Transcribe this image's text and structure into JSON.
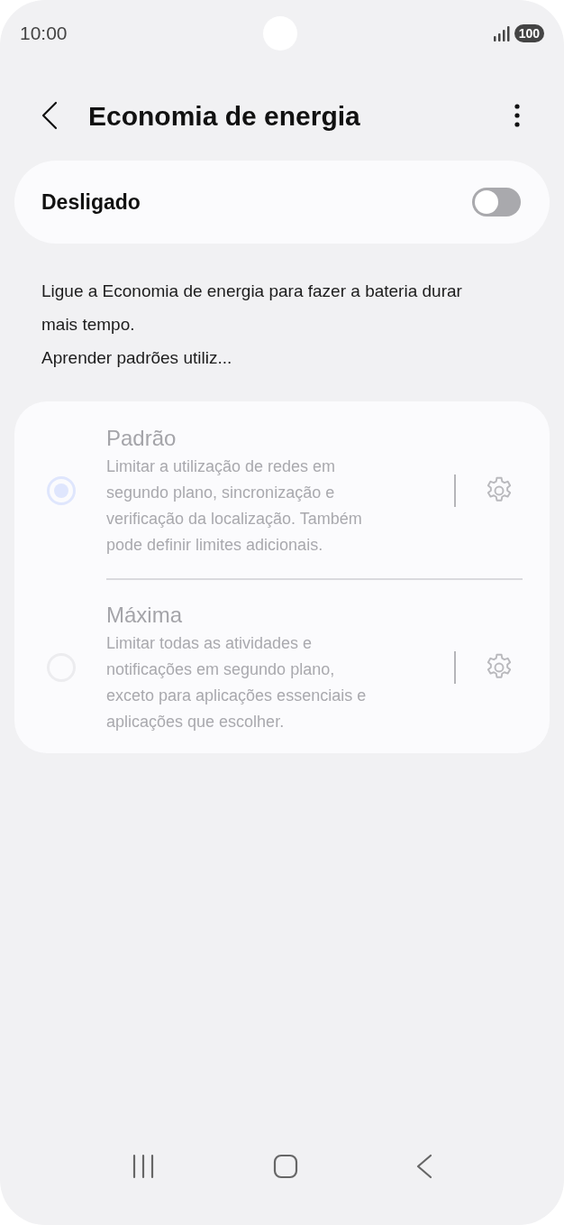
{
  "status_bar": {
    "time": "10:00",
    "battery": "100"
  },
  "header": {
    "title": "Economia de energia"
  },
  "master_switch": {
    "label": "Desligado",
    "on": false
  },
  "description": [
    "Ligue a Economia de energia para fazer a bateria durar mais tempo.",
    "Aprender padrões utiliz..."
  ],
  "modes": [
    {
      "title": "Padrão",
      "description": "Limitar a utilização de redes em segundo plano, sincronização e verificação da localização. Também pode definir limites adicionais.",
      "selected": true,
      "disabled": true
    },
    {
      "title": "Máxima",
      "description": "Limitar todas as atividades e notificações em segundo plano, exceto para aplicações essenciais e aplicações que escolher.",
      "selected": false,
      "disabled": true
    }
  ]
}
